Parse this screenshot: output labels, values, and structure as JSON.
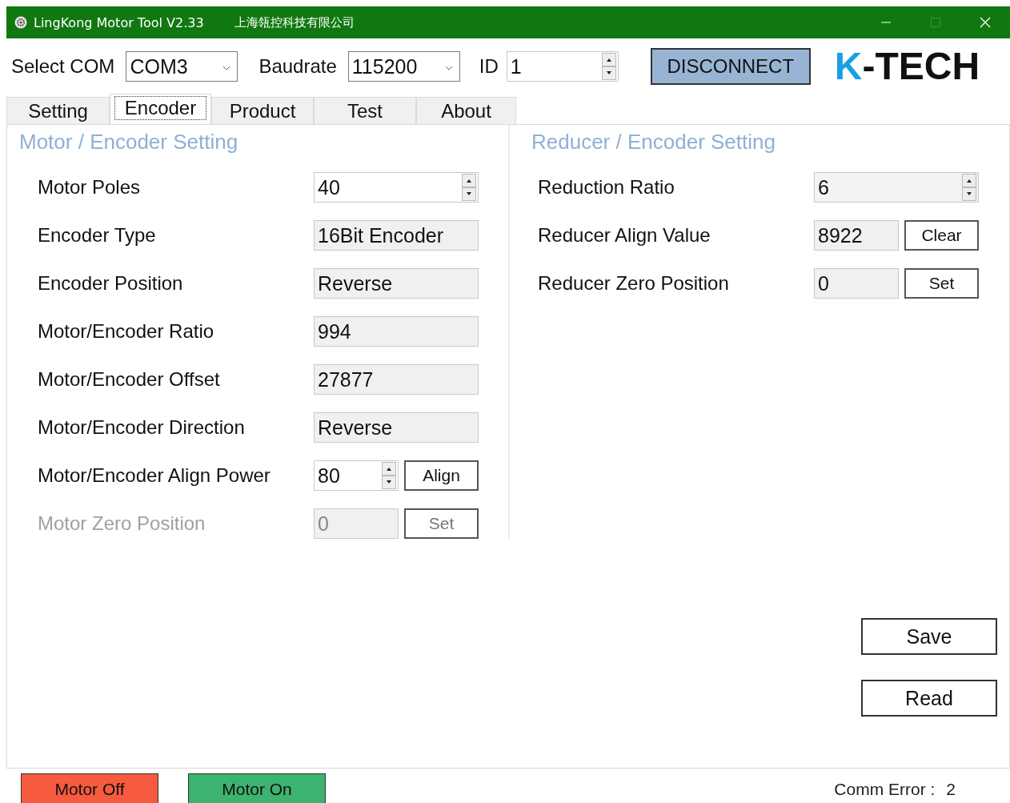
{
  "window": {
    "title": "LingKong Motor Tool V2.33",
    "company": "上海瓴控科技有限公司"
  },
  "toolbar": {
    "com_label": "Select COM",
    "com_value": "COM3",
    "baud_label": "Baudrate",
    "baud_value": "115200",
    "id_label": "ID",
    "id_value": "1",
    "connect_button": "DISCONNECT"
  },
  "logo": [
    {
      "text": "K",
      "color": "#1a9fe3"
    },
    {
      "text": "-TECH",
      "color": "#111111"
    }
  ],
  "tabs": [
    {
      "label": "Setting",
      "selected": false
    },
    {
      "label": "Encoder",
      "selected": true
    },
    {
      "label": "Product",
      "selected": false
    },
    {
      "label": "Test",
      "selected": false
    },
    {
      "label": "About",
      "selected": false
    }
  ],
  "motor_group": {
    "title": "Motor / Encoder Setting",
    "rows": [
      {
        "kind": "spin",
        "label": "Motor Poles",
        "value": "40",
        "readonly": false,
        "disabled": false
      },
      {
        "kind": "field",
        "label": "Encoder Type",
        "value": "16Bit Encoder",
        "readonly": true,
        "disabled": false
      },
      {
        "kind": "field",
        "label": "Encoder Position",
        "value": "Reverse",
        "readonly": true,
        "disabled": false
      },
      {
        "kind": "field",
        "label": "Motor/Encoder Ratio",
        "value": "994",
        "readonly": true,
        "disabled": false
      },
      {
        "kind": "field",
        "label": "Motor/Encoder Offset",
        "value": "27877",
        "readonly": true,
        "disabled": false
      },
      {
        "kind": "field",
        "label": "Motor/Encoder Direction",
        "value": "Reverse",
        "readonly": true,
        "disabled": false
      },
      {
        "kind": "spin-action",
        "label": "Motor/Encoder Align Power",
        "value": "80",
        "action": "Align",
        "readonly": false,
        "disabled": false
      },
      {
        "kind": "field-action",
        "label": "Motor Zero Position",
        "value": "0",
        "action": "Set",
        "readonly": true,
        "disabled": true
      }
    ]
  },
  "reducer_group": {
    "title": "Reducer / Encoder Setting",
    "rows": [
      {
        "kind": "spin",
        "label": "Reduction Ratio",
        "value": "6",
        "readonly": true,
        "disabled": false
      },
      {
        "kind": "field-action",
        "label": "Reducer Align Value",
        "value": "8922",
        "action": "Clear",
        "readonly": true,
        "disabled": false
      },
      {
        "kind": "field-action",
        "label": "Reducer Zero Position",
        "value": "0",
        "action": "Set",
        "readonly": true,
        "disabled": false
      }
    ]
  },
  "actions": [
    "Save",
    "Read"
  ],
  "footer": {
    "motor_buttons": [
      {
        "label": "Motor Off",
        "color": "#f65a3f"
      },
      {
        "label": "Motor On",
        "color": "#3db370"
      }
    ],
    "comm_error_label": "Comm Error :",
    "comm_error_value": "2"
  }
}
